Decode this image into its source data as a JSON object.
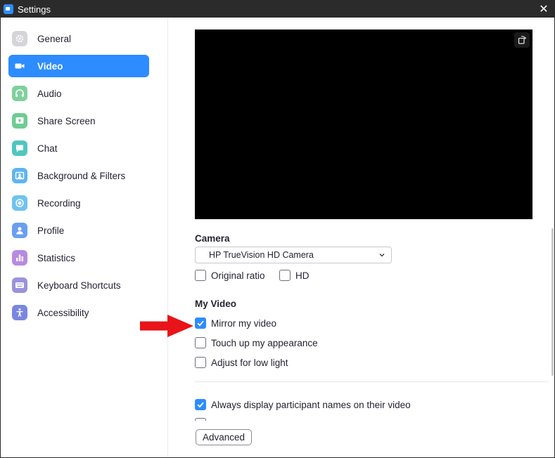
{
  "window": {
    "title": "Settings",
    "close_glyph": "✕"
  },
  "sidebar": {
    "items": [
      {
        "label": "General",
        "icon": "gear-icon",
        "color": "#d5d5d9"
      },
      {
        "label": "Video",
        "icon": "video-camera-icon",
        "color": "#2d8cff",
        "active": true
      },
      {
        "label": "Audio",
        "icon": "headphones-icon",
        "color": "#7fd09c"
      },
      {
        "label": "Share Screen",
        "icon": "share-screen-icon",
        "color": "#6ecc93"
      },
      {
        "label": "Chat",
        "icon": "chat-bubble-icon",
        "color": "#4fc6c0"
      },
      {
        "label": "Background & Filters",
        "icon": "background-icon",
        "color": "#5fb4f0"
      },
      {
        "label": "Recording",
        "icon": "record-icon",
        "color": "#6ec3f0"
      },
      {
        "label": "Profile",
        "icon": "profile-icon",
        "color": "#6a9ff0"
      },
      {
        "label": "Statistics",
        "icon": "statistics-icon",
        "color": "#b98ae0"
      },
      {
        "label": "Keyboard Shortcuts",
        "icon": "keyboard-icon",
        "color": "#9a93dc"
      },
      {
        "label": "Accessibility",
        "icon": "accessibility-icon",
        "color": "#7a86e0"
      }
    ]
  },
  "main": {
    "camera": {
      "section_title": "Camera",
      "selected_camera": "HP TrueVision HD Camera",
      "original_ratio_label": "Original ratio",
      "original_ratio_checked": false,
      "hd_label": "HD",
      "hd_checked": false
    },
    "my_video": {
      "section_title": "My Video",
      "mirror_label": "Mirror my video",
      "mirror_checked": true,
      "touch_up_label": "Touch up my appearance",
      "touch_up_checked": false,
      "low_light_label": "Adjust for low light",
      "low_light_checked": false
    },
    "participant_names_label": "Always display participant names on their video",
    "participant_names_checked": true,
    "advanced_button": "Advanced"
  },
  "colors": {
    "accent": "#2d8cff",
    "annotation_arrow": "#e8141a"
  }
}
